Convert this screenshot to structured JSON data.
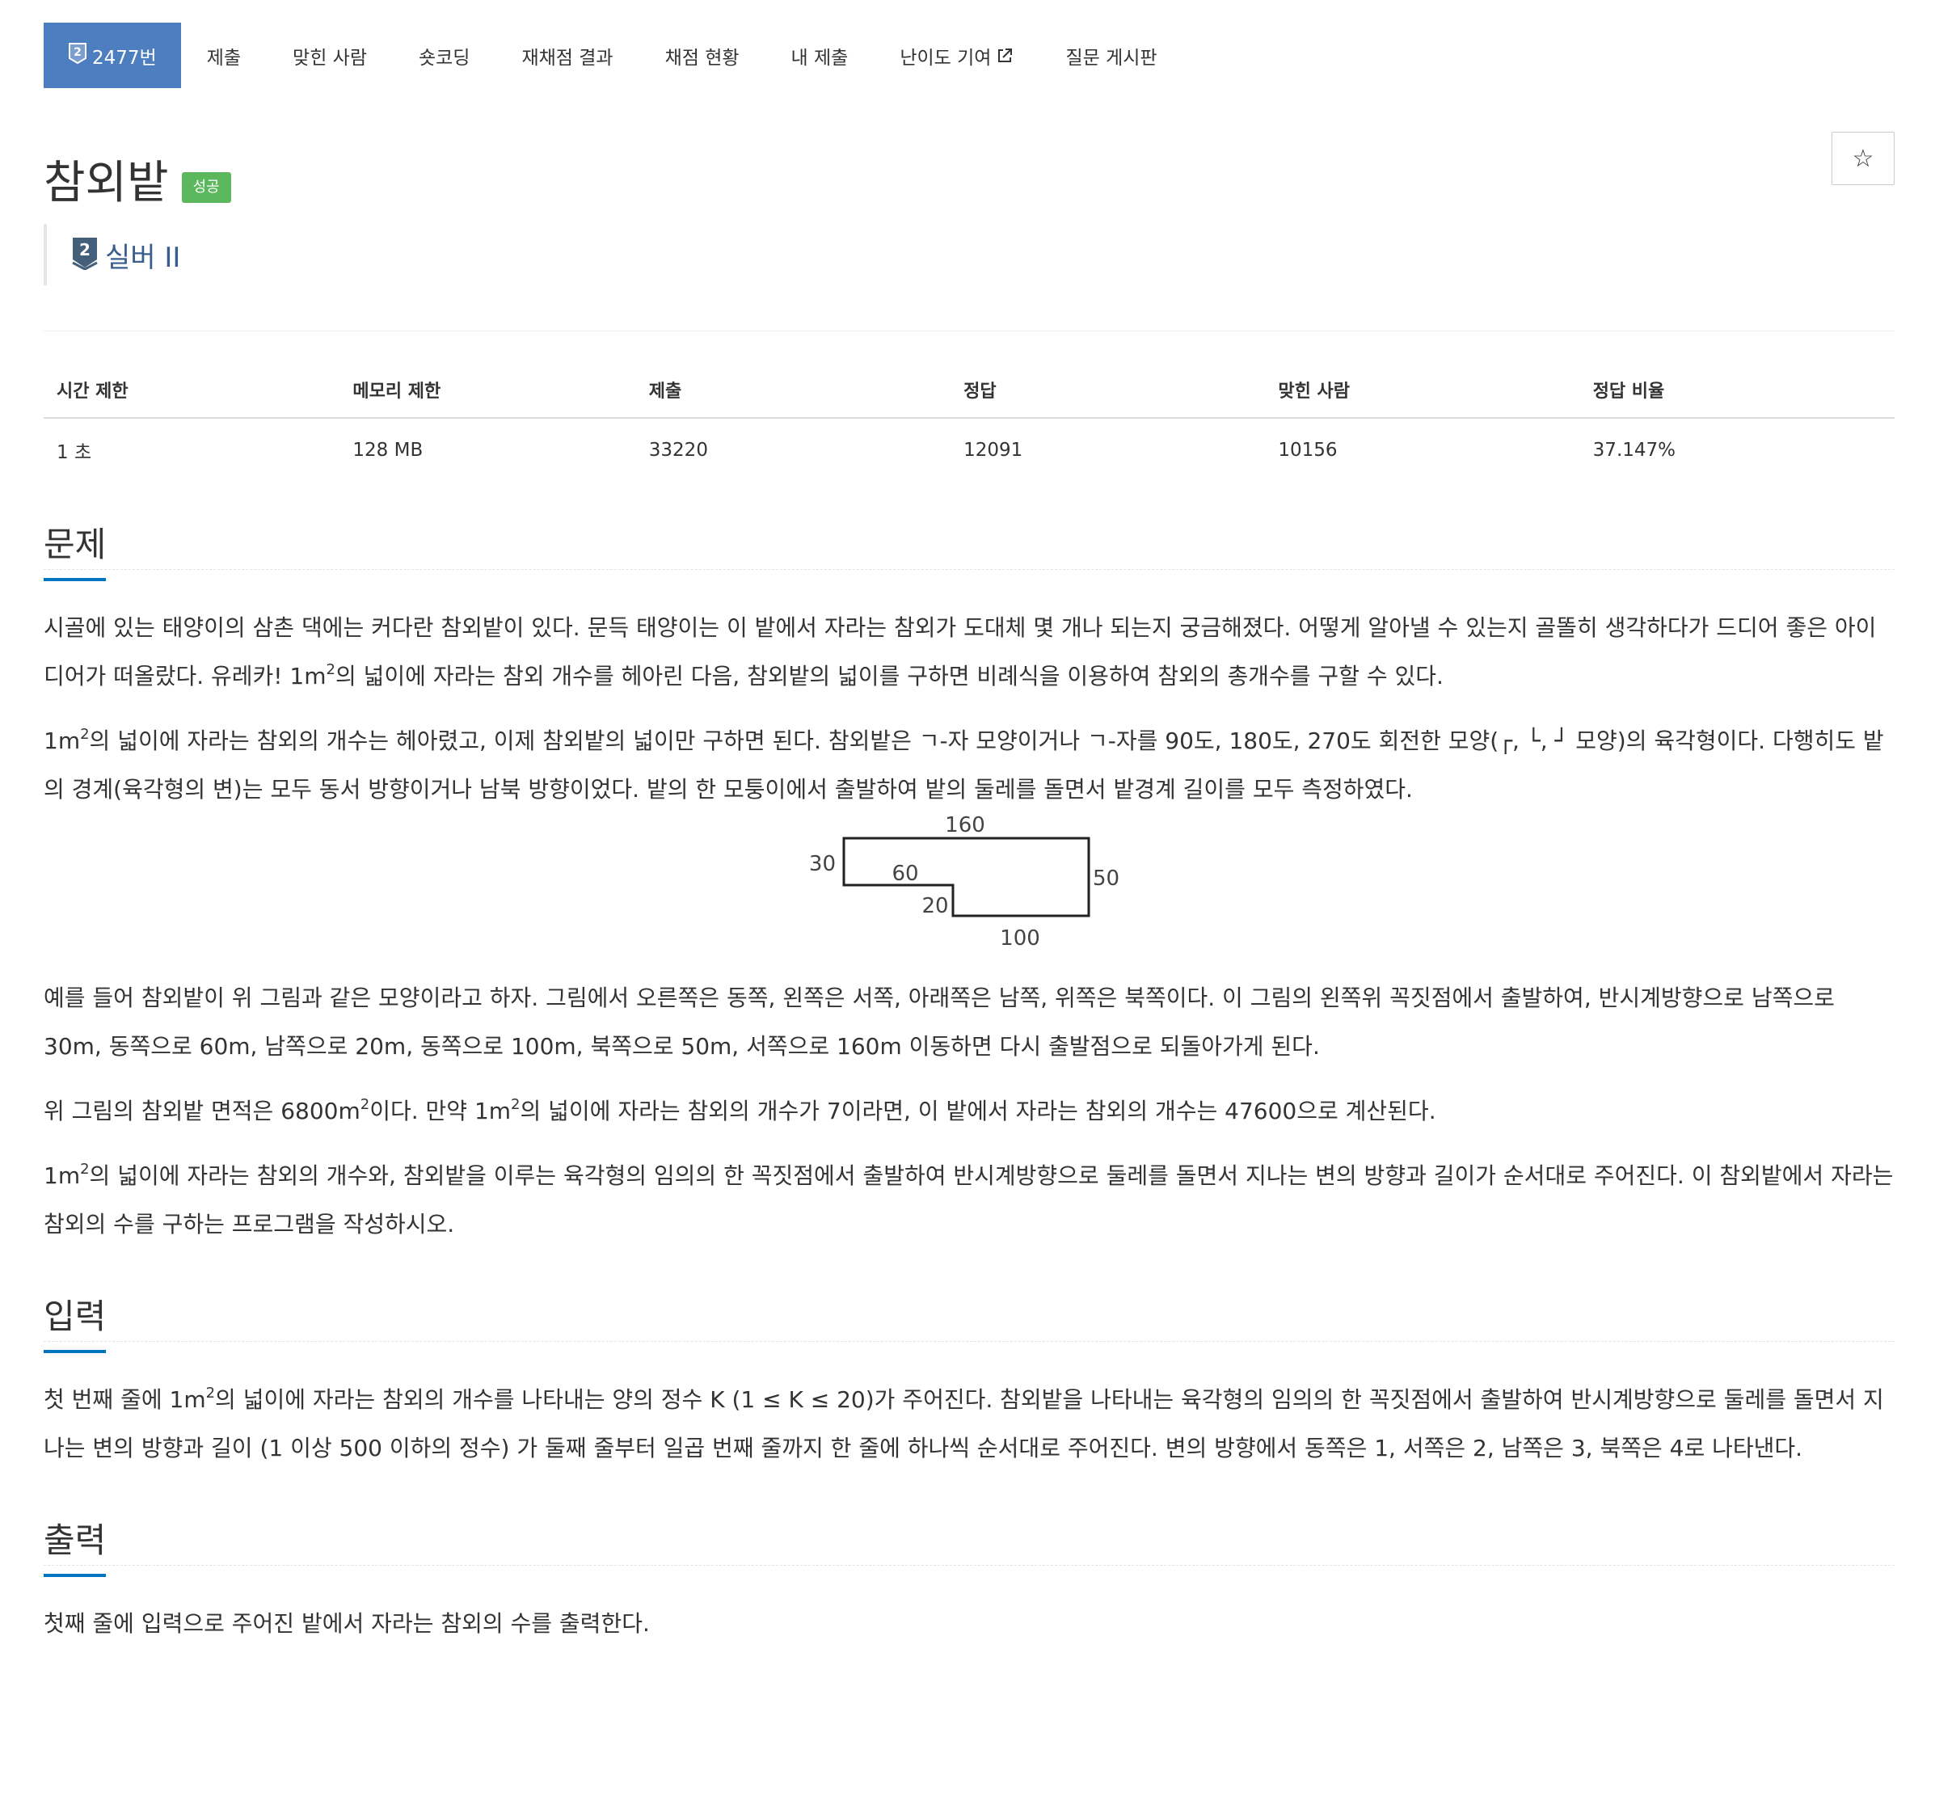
{
  "nav": {
    "problem_id": "2477번",
    "tabs": [
      "제출",
      "맞힌 사람",
      "숏코딩",
      "재채점 결과",
      "채점 현황",
      "내 제출",
      "난이도 기여",
      "질문 게시판"
    ]
  },
  "title": "참외밭",
  "badge": "성공",
  "star": "☆",
  "tier": {
    "number": "2",
    "label": "실버 II"
  },
  "info": {
    "headers": [
      "시간 제한",
      "메모리 제한",
      "제출",
      "정답",
      "맞힌 사람",
      "정답 비율"
    ],
    "values": [
      "1 초",
      "128 MB",
      "33220",
      "12091",
      "10156",
      "37.147%"
    ]
  },
  "sections": {
    "problem": "문제",
    "input": "입력",
    "output": "출력"
  },
  "problem": {
    "p1a": "시골에 있는 태양이의 삼촌 댁에는 커다란 참외밭이 있다. 문득 태양이는 이 밭에서 자라는 참외가 도대체 몇 개나 되는지 궁금해졌다. 어떻게 알아낼 수 있는지 골똘히 생각하다가 드디어 좋은 아이디어가 떠올랐다. 유레카! 1m",
    "p1b": "의 넓이에 자라는 참외 개수를 헤아린 다음, 참외밭의 넓이를 구하면 비례식을 이용하여 참외의 총개수를 구할 수 있다.",
    "p2a": "1m",
    "p2b": "의 넓이에 자라는 참외의 개수는 헤아렸고, 이제 참외밭의 넓이만 구하면 된다. 참외밭은 ㄱ-자 모양이거나 ㄱ-자를 90도, 180도, 270도 회전한 모양(┌, └, ┘ 모양)의 육각형이다. 다행히도 밭의 경계(육각형의 변)는 모두 동서 방향이거나 남북 방향이었다. 밭의 한 모퉁이에서 출발하여 밭의 둘레를 돌면서 밭경계 길이를 모두 측정하였다.",
    "p3": "예를 들어 참외밭이 위 그림과 같은 모양이라고 하자. 그림에서 오른쪽은 동쪽, 왼쪽은 서쪽, 아래쪽은 남쪽, 위쪽은 북쪽이다. 이 그림의 왼쪽위 꼭짓점에서 출발하여, 반시계방향으로 남쪽으로 30m, 동쪽으로 60m, 남쪽으로 20m, 동쪽으로 100m, 북쪽으로 50m, 서쪽으로 160m 이동하면 다시 출발점으로 되돌아가게 된다.",
    "p4a": "위 그림의 참외밭  면적은 6800m",
    "p4b": "이다. 만약 1m",
    "p4c": "의 넓이에 자라는 참외의 개수가 7이라면, 이 밭에서 자라는 참외의 개수는 47600으로 계산된다.",
    "p5a": "1m",
    "p5b": "의 넓이에 자라는 참외의 개수와, 참외밭을 이루는 육각형의 임의의 한 꼭짓점에서 출발하여 반시계방향으로 둘레를 돌면서 지나는 변의 방향과 길이가 순서대로 주어진다. 이 참외밭에서 자라는 참외의 수를 구하는 프로그램을 작성하시오.",
    "sup": "2",
    "figure_labels": {
      "top": "160",
      "left": "30",
      "inner_h": "60",
      "inner_v": "20",
      "bottom": "100",
      "right": "50"
    }
  },
  "input": {
    "p1a": "첫 번째 줄에 1m",
    "p1b": "의 넓이에 자라는 참외의 개수를 나타내는 양의 정수 K (1 ≤ K ≤ 20)가 주어진다. 참외밭을 나타내는 육각형의 임의의 한 꼭짓점에서 출발하여 반시계방향으로 둘레를 돌면서 지나는 변의 방향과 길이 (1 이상 500 이하의 정수) 가 둘째 줄부터 일곱 번째 줄까지 한 줄에 하나씩 순서대로 주어진다. 변의 방향에서 동쪽은 1, 서쪽은 2, 남쪽은 3, 북쪽은 4로 나타낸다."
  },
  "output": {
    "p1": "첫째 줄에 입력으로 주어진 밭에서 자라는 참외의 수를 출력한다."
  }
}
